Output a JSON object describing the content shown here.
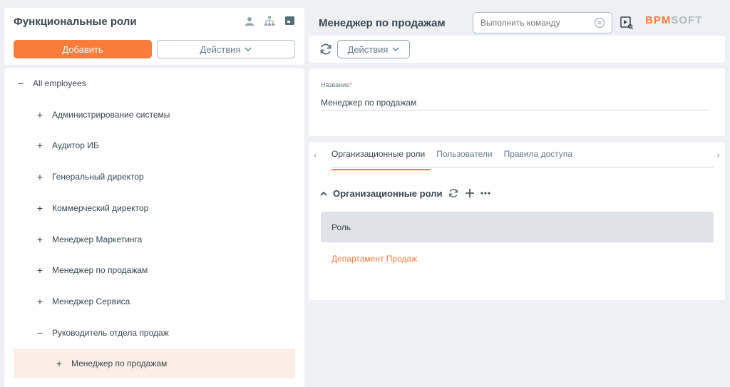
{
  "left": {
    "title": "Функциональные роли",
    "add_label": "Добавить",
    "actions_label": "Действия",
    "header_icons": [
      "user-icon",
      "org-structure-icon",
      "folder-icon"
    ]
  },
  "tree": {
    "items": [
      {
        "sign": "−",
        "label": "All employees",
        "level": 0
      },
      {
        "sign": "+",
        "label": "Администрирование системы",
        "level": 1
      },
      {
        "sign": "+",
        "label": "Аудитор ИБ",
        "level": 1
      },
      {
        "sign": "+",
        "label": "Генеральный директор",
        "level": 1
      },
      {
        "sign": "+",
        "label": "Коммерческий директор",
        "level": 1
      },
      {
        "sign": "+",
        "label": "Менеджер Маркетинга",
        "level": 1
      },
      {
        "sign": "+",
        "label": "Менеджер по продажам",
        "level": 1
      },
      {
        "sign": "+",
        "label": "Менеджер Сервиса",
        "level": 1
      },
      {
        "sign": "−",
        "label": "Руководитель отдела продаж",
        "level": 1
      },
      {
        "sign": "+",
        "label": "Менеджер по продажам",
        "level": 2,
        "selected": true
      }
    ]
  },
  "right": {
    "title": "Менеджер по продажам",
    "command_placeholder": "Выполнить команду",
    "logo_a": "BPM",
    "logo_b": "SOFT",
    "actions_label": "Действия",
    "field_label": "Название",
    "field_required": "*",
    "field_value": "Менеджер по продажам",
    "tabs": [
      "Организационные роли",
      "Пользователи",
      "Правила доступа"
    ],
    "active_tab": 0,
    "detail_title": "Организационные роли",
    "grid_column": "Роль",
    "grid_rows": [
      "Департамент Продаж"
    ]
  },
  "colors": {
    "accent": "#fb7b3b",
    "selected_bg": "#fdeee5",
    "grid_header": "#dfe3e8"
  }
}
